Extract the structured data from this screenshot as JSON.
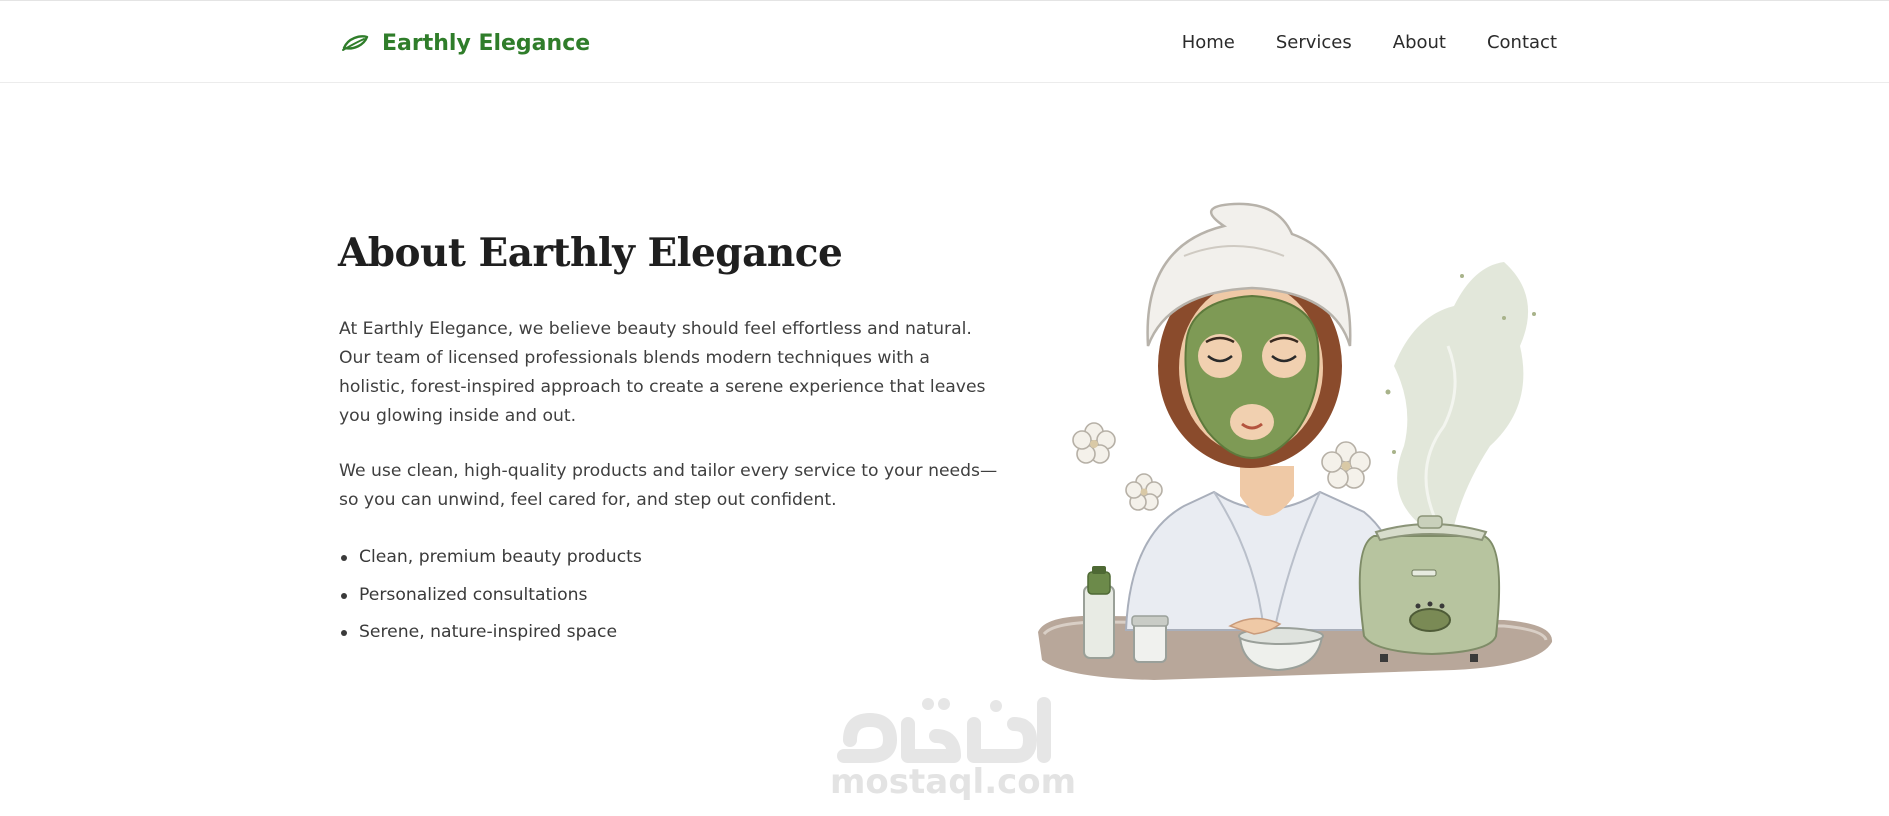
{
  "header": {
    "brand": {
      "name": "Earthly Elegance",
      "icon": "leaf-icon",
      "color": "#2f7d2a"
    },
    "nav": [
      {
        "label": "Home"
      },
      {
        "label": "Services"
      },
      {
        "label": "About"
      },
      {
        "label": "Contact"
      }
    ]
  },
  "about": {
    "title": "About Earthly Elegance",
    "paragraph1_lines": [
      "At Earthly Elegance, we believe beauty should feel effortless and natural.",
      "Our team of licensed professionals blends modern techniques with a",
      "holistic, forest-inspired approach to create a serene experience that leaves",
      "you glowing inside and out."
    ],
    "paragraph2_lines": [
      "We use clean, high-quality products and tailor every service to your needs—",
      "so you can unwind, feel cared for, and step out confident."
    ],
    "features": [
      "Clean, premium beauty products",
      "Personalized consultations",
      "Serene, nature-inspired space"
    ],
    "illustration": "woman-with-face-mask-and-steamer-illustration"
  },
  "watermark": {
    "text": "mostaql.com",
    "glyph_text": "مستقل"
  }
}
